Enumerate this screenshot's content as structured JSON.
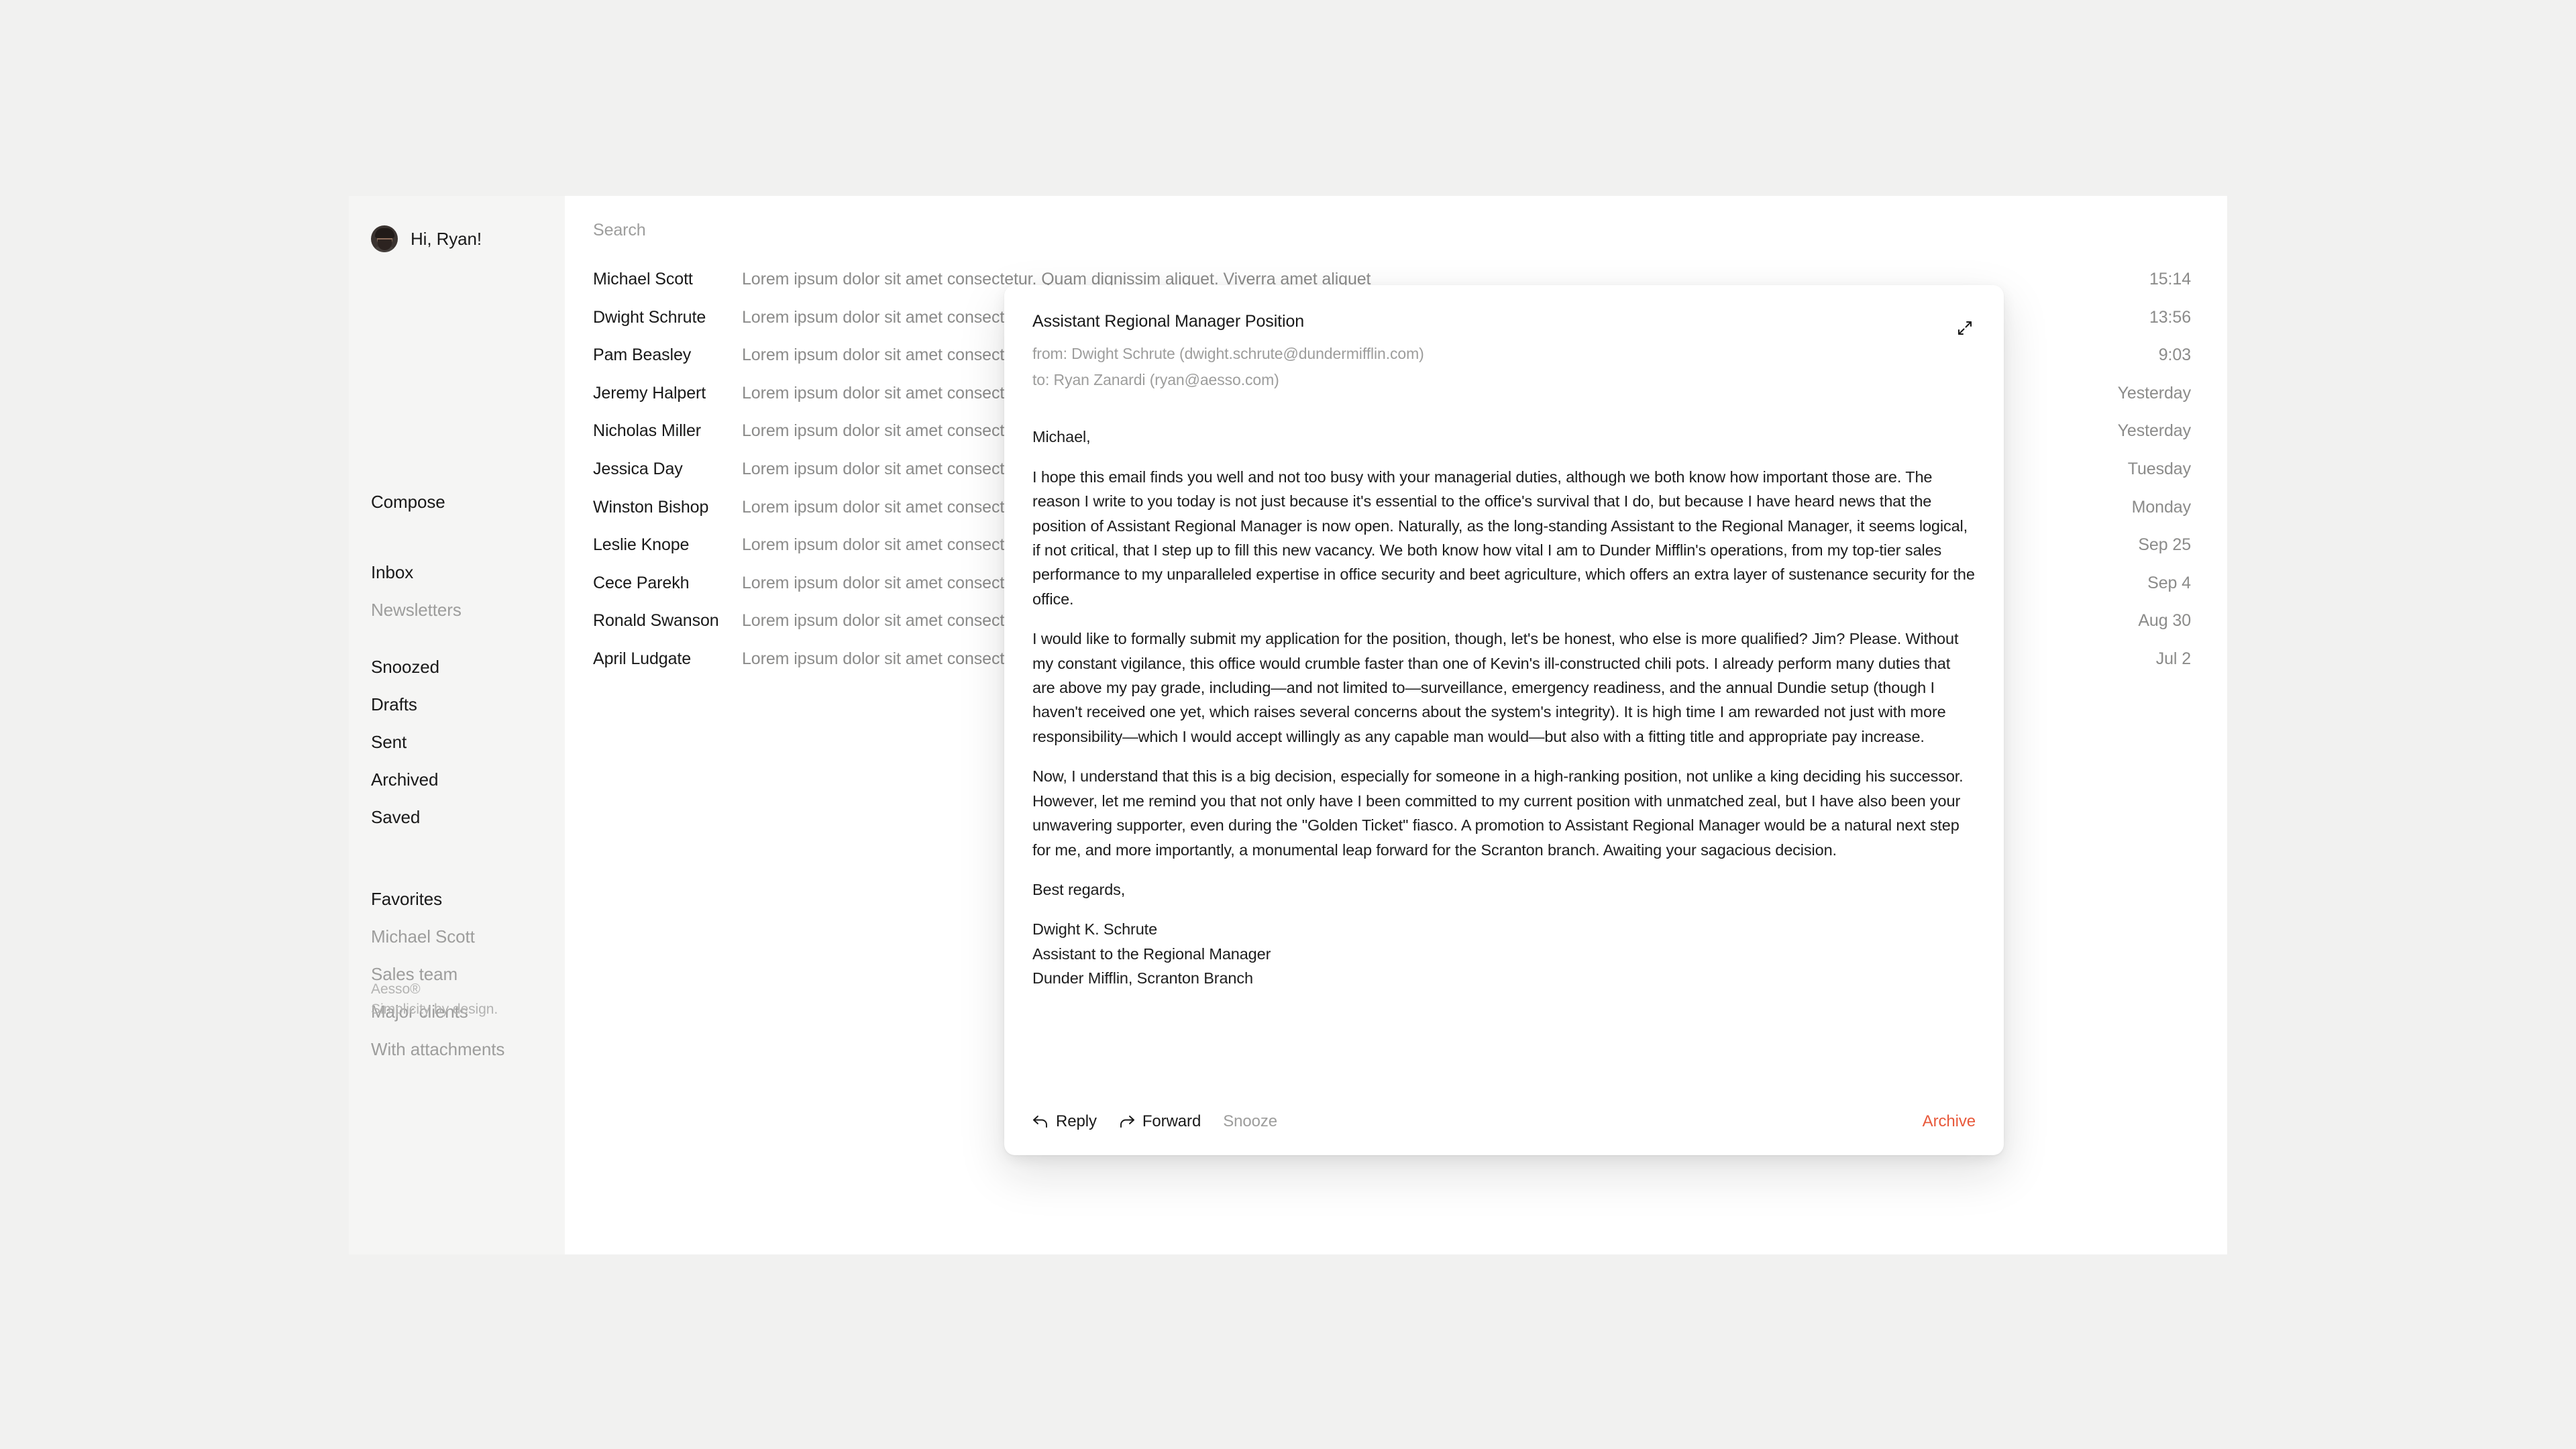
{
  "app": {
    "name": "Aesso",
    "footer_brand": "Aesso®",
    "footer_tagline": "Simplicity by design."
  },
  "sidebar": {
    "greeting": "Hi, Ryan!",
    "avatar_name": "user-avatar",
    "compose_label": "Compose",
    "nav_items": [
      {
        "label": "Inbox",
        "muted": false
      },
      {
        "label": "Newsletters",
        "muted": true
      },
      {
        "label": "Snoozed",
        "muted": false
      },
      {
        "label": "Drafts",
        "muted": false
      },
      {
        "label": "Sent",
        "muted": false
      },
      {
        "label": "Archived",
        "muted": false
      },
      {
        "label": "Saved",
        "muted": false
      }
    ],
    "favorites_heading": "Favorites",
    "favorites": [
      {
        "label": "Michael Scott"
      },
      {
        "label": "Sales team"
      },
      {
        "label": "Major clients"
      },
      {
        "label": "With attachments"
      }
    ]
  },
  "search": {
    "placeholder": "Search",
    "value": ""
  },
  "mail_list": [
    {
      "sender": "Michael Scott",
      "preview": "Lorem ipsum dolor sit amet consectetur. Quam dignissim aliquet. Viverra amet aliquet",
      "time": "15:14"
    },
    {
      "sender": "Dwight Schrute",
      "preview": "Lorem ipsum dolor sit amet consectetur. Sit amet aliquam diam proin. Sagittis",
      "time": "13:56"
    },
    {
      "sender": "Pam Beasley",
      "preview": "Lorem ipsum dolor sit amet consectetur. Blandit pellentesque enim. Iaculis urna",
      "time": "9:03"
    },
    {
      "sender": "Jeremy Halpert",
      "preview": "Lorem ipsum dolor sit amet consectetur. Interdum venenatis nisl nibh sit",
      "time": "Yesterday"
    },
    {
      "sender": "Nicholas Miller",
      "preview": "Lorem ipsum dolor sit amet consectetur. Risus mauris. Dolor eget a habitant massa",
      "time": "Yesterday"
    },
    {
      "sender": "Jessica Day",
      "preview": "Lorem ipsum dolor sit amet consectetur. Sit amet volutpat velit. Mi tellus turpis nisi id",
      "time": "Tuesday"
    },
    {
      "sender": "Winston Bishop",
      "preview": "Lorem ipsum dolor sit amet consectetur. Imperdiet. Viverra egestas nunc tristique sem",
      "time": "Monday"
    },
    {
      "sender": "Leslie Knope",
      "preview": "Lorem ipsum dolor sit amet consectetur. Hendrerit ultrices sed nam leo. Eu id egestas",
      "time": "Sep 25"
    },
    {
      "sender": "Cece Parekh",
      "preview": "Lorem ipsum dolor sit amet consectetur. Tincidunt tortor eget consectetur. Turpis",
      "time": "Sep 4"
    },
    {
      "sender": "Ronald Swanson",
      "preview": "Lorem ipsum dolor sit amet consectetur. Risus lorem cursus cras. Adipiscing mattis",
      "time": "Aug 30"
    },
    {
      "sender": "April Ludgate",
      "preview": "Lorem ipsum dolor sit amet consectetur. Neque quis in fames fermentum ut vitae",
      "time": "Jul 2"
    }
  ],
  "email": {
    "subject": "Assistant Regional Manager Position",
    "from": "from: Dwight Schrute (dwight.schrute@dundermifflin.com)",
    "to": "to: Ryan Zanardi (ryan@aesso.com)",
    "expand_icon": "expand-diagonal-icon",
    "salutation": "Michael,",
    "paragraph_1": "I hope this email finds you well and not too busy with your managerial duties, although we both know how important those are. The reason I write to you today is not just because it's essential to the office's survival that I do, but because I have heard news that the position of Assistant Regional Manager is now open. Naturally, as the long-standing Assistant to the Regional Manager, it seems logical, if not critical, that I step up to fill this new vacancy. We both know how vital I am to Dunder Mifflin's operations, from my top-tier sales performance to my unparalleled expertise in office security and beet agriculture, which offers an extra layer of sustenance security for the office.",
    "paragraph_2": "I would like to formally submit my application for the position, though, let's be honest, who else is more qualified? Jim? Please. Without my constant vigilance, this office would crumble faster than one of Kevin's ill-constructed chili pots. I already perform many duties that are above my pay grade, including—and not limited to—surveillance, emergency readiness, and the annual Dundie setup (though I haven't received one yet, which raises several concerns about the system's integrity). It is high time I am rewarded not just with more responsibility—which I would accept willingly as any capable man would—but also with a fitting title and appropriate pay increase.",
    "paragraph_3": "Now, I understand that this is a big decision, especially for someone in a high-ranking position, not unlike a king deciding his successor. However, let me remind you that not only have I been committed to my current position with unmatched zeal, but I have also been your unwavering supporter, even during the \"Golden Ticket\" fiasco. A promotion to Assistant Regional Manager would be a natural next step for me, and more importantly, a monumental leap forward for the Scranton branch. Awaiting your sagacious decision.",
    "closing": "Best regards,",
    "sig_name": "Dwight K. Schrute",
    "sig_title": "Assistant to the Regional Manager",
    "sig_company": "Dunder Mifflin, Scranton Branch",
    "actions": {
      "reply": "Reply",
      "forward": "Forward",
      "snooze": "Snooze",
      "archive": "Archive"
    }
  },
  "colors": {
    "page_background": "#f1f1f0",
    "app_background": "#ffffff",
    "sidebar_background": "#f5f5f4",
    "text_primary": "#191919",
    "text_muted": "#9d9d9c",
    "text_preview": "#8b8b8a",
    "accent_archive": "#e8593b"
  }
}
